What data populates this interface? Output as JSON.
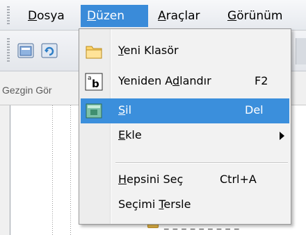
{
  "menubar": {
    "items": [
      {
        "pre": "",
        "u": "D",
        "post": "osya"
      },
      {
        "pre": "",
        "u": "D",
        "post": "üzen"
      },
      {
        "pre": "",
        "u": "A",
        "post": "raçlar"
      },
      {
        "pre": "",
        "u": "G",
        "post": "örünüm"
      }
    ],
    "active_index": 1
  },
  "toolbar": {
    "buttons": [
      "new-folder-icon",
      "refresh-icon"
    ]
  },
  "panel": {
    "title": "Gezgin Gör"
  },
  "menu": {
    "items": [
      {
        "name": "new-folder",
        "pre": "",
        "u": "Y",
        "post": "eni Klasör",
        "shortcut": "",
        "icon": "folder-icon"
      },
      {
        "name": "rename",
        "pre": "Yeniden A",
        "u": "d",
        "post": "landır",
        "shortcut": "F2",
        "icon": "rename-icon"
      },
      {
        "name": "delete",
        "pre": "",
        "u": "S",
        "post": "il",
        "shortcut": "Del",
        "icon": "delete-icon",
        "highlighted": true
      },
      {
        "name": "add",
        "pre": "",
        "u": "E",
        "post": "kle",
        "shortcut": "",
        "icon": "",
        "submenu": true
      },
      {
        "name": "select-all",
        "pre": "",
        "u": "H",
        "post": "epsini Seç",
        "shortcut": "Ctrl+A",
        "icon": ""
      },
      {
        "name": "invert-selection",
        "pre": "Seçimi ",
        "u": "T",
        "post": "ersle",
        "shortcut": "",
        "icon": ""
      }
    ]
  },
  "background": {
    "fragment_text": "_ _ _ _ _ _ _ _ _"
  },
  "colors": {
    "highlight": "#3b8fdc",
    "menubar_active": "#3a8bd9"
  }
}
